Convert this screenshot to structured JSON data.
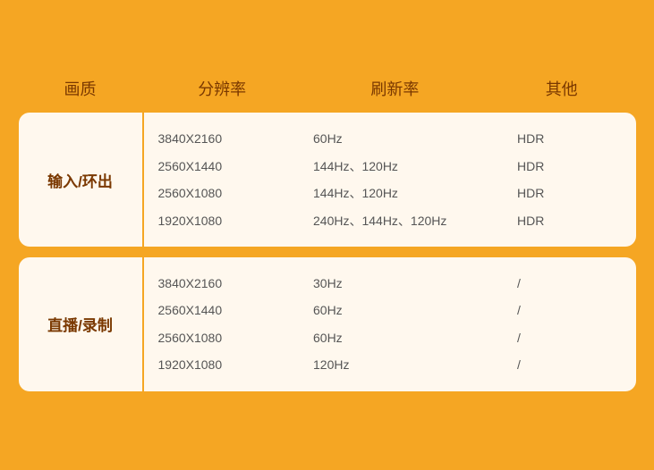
{
  "header": {
    "quality_label": "画质",
    "resolution_label": "分辨率",
    "refresh_label": "刷新率",
    "other_label": "其他"
  },
  "rows": [
    {
      "id": "input-output",
      "quality": "输入/环出",
      "entries": [
        {
          "resolution": "3840X2160",
          "refresh": "60Hz",
          "other": "HDR"
        },
        {
          "resolution": "2560X1440",
          "refresh": "144Hz、120Hz",
          "other": "HDR"
        },
        {
          "resolution": "2560X1080",
          "refresh": "144Hz、120Hz",
          "other": "HDR"
        },
        {
          "resolution": "1920X1080",
          "refresh": "240Hz、144Hz、120Hz",
          "other": "HDR"
        }
      ]
    },
    {
      "id": "live-record",
      "quality": "直播/录制",
      "entries": [
        {
          "resolution": "3840X2160",
          "refresh": "30Hz",
          "other": "/"
        },
        {
          "resolution": "2560X1440",
          "refresh": "60Hz",
          "other": "/"
        },
        {
          "resolution": "2560X1080",
          "refresh": "60Hz",
          "other": "/"
        },
        {
          "resolution": "1920X1080",
          "refresh": "120Hz",
          "other": "/"
        }
      ]
    }
  ]
}
